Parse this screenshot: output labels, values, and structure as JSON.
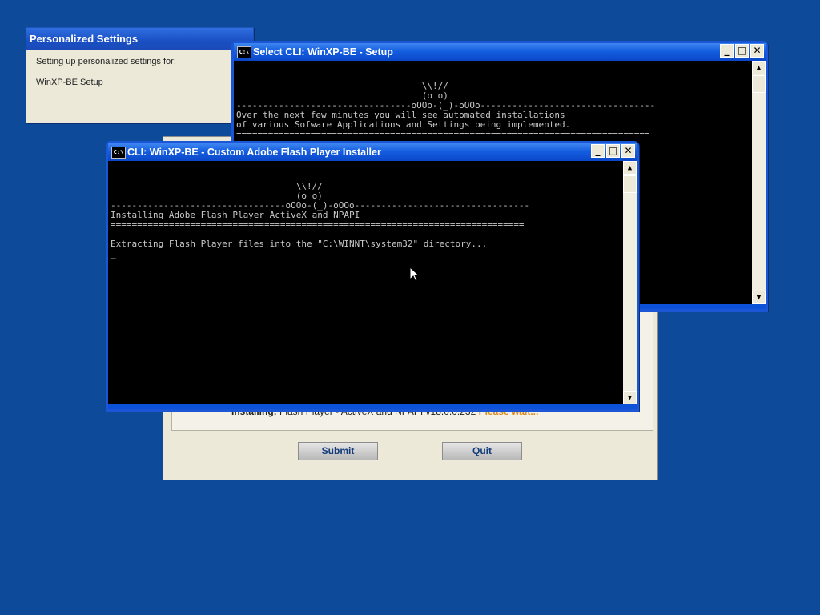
{
  "personalized_settings": {
    "title": "Personalized Settings",
    "line1": "Setting up personalized settings for:",
    "line2": "WinXP-BE Setup"
  },
  "select_cli": {
    "title": "Select CLI: WinXP-BE - Setup",
    "console_text": "                                   \\\\!//\n                                   (o o)\n---------------------------------oOOo-(_)-oOOo---------------------------------\nOver the next few minutes you will see automated installations\nof various Sofware Applications and Settings being implemented.\n=============================================================================="
  },
  "flash_installer": {
    "title": "CLI: WinXP-BE - Custom Adobe Flash Player Installer",
    "console_text": "                                   \\\\!//\n                                   (o o)\n---------------------------------oOOo-(_)-oOOo---------------------------------\nInstalling Adobe Flash Player ActiveX and NPAPI\n==============================================================================\n\nExtracting Flash Player files into the \"C:\\WINNT\\system32\" directory...\n_"
  },
  "setup_dialog": {
    "installing_label": "Installing:",
    "installing_item": "Flash Player - ActiveX and NPAPI v18.0.0.232",
    "please_wait": "Please wait...",
    "submit_label": "Submit",
    "quit_label": "Quit"
  },
  "window_controls": {
    "minimize": "_",
    "maximize": "□",
    "close": "✕"
  },
  "colors": {
    "desktop": "#0e4a9a",
    "title_blue": "#1a56d6",
    "please_wait": "#e0891c"
  }
}
